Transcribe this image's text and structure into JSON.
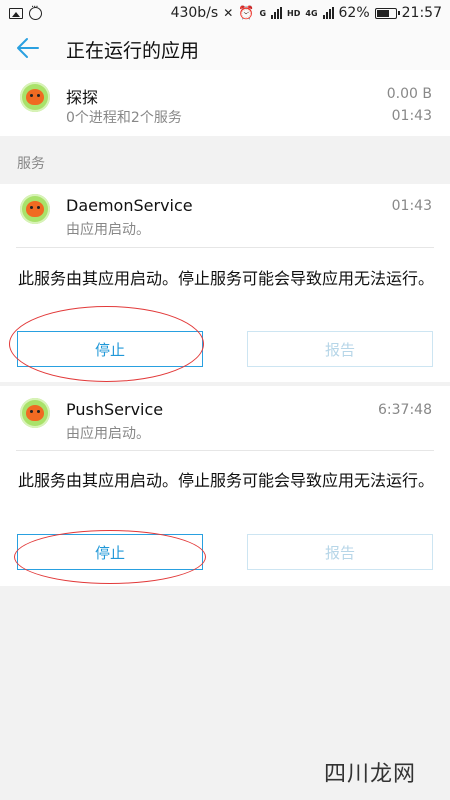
{
  "status_bar": {
    "speed": "430b/s",
    "signal_label": "G",
    "hd_label": "HD",
    "lte_label": "4G",
    "battery": "62%",
    "time": "21:57"
  },
  "header": {
    "title": "正在运行的应用"
  },
  "app": {
    "name": "探探",
    "detail": "0个进程和2个服务",
    "size": "0.00 B",
    "time": "01:43"
  },
  "section": {
    "label": "服务"
  },
  "services": [
    {
      "name": "DaemonService",
      "started_by": "由应用启动。",
      "time": "01:43",
      "description": "此服务由其应用启动。停止服务可能会导致应用无法运行。",
      "stop_label": "停止",
      "report_label": "报告"
    },
    {
      "name": "PushService",
      "started_by": "由应用启动。",
      "time": "6:37:48",
      "description": "此服务由其应用启动。停止服务可能会导致应用无法运行。",
      "stop_label": "停止",
      "report_label": "报告"
    }
  ],
  "watermark": "四川龙网",
  "colors": {
    "accent": "#29a0e0",
    "annotation": "#e23a3a",
    "icon_bg": "#a9e26a"
  }
}
